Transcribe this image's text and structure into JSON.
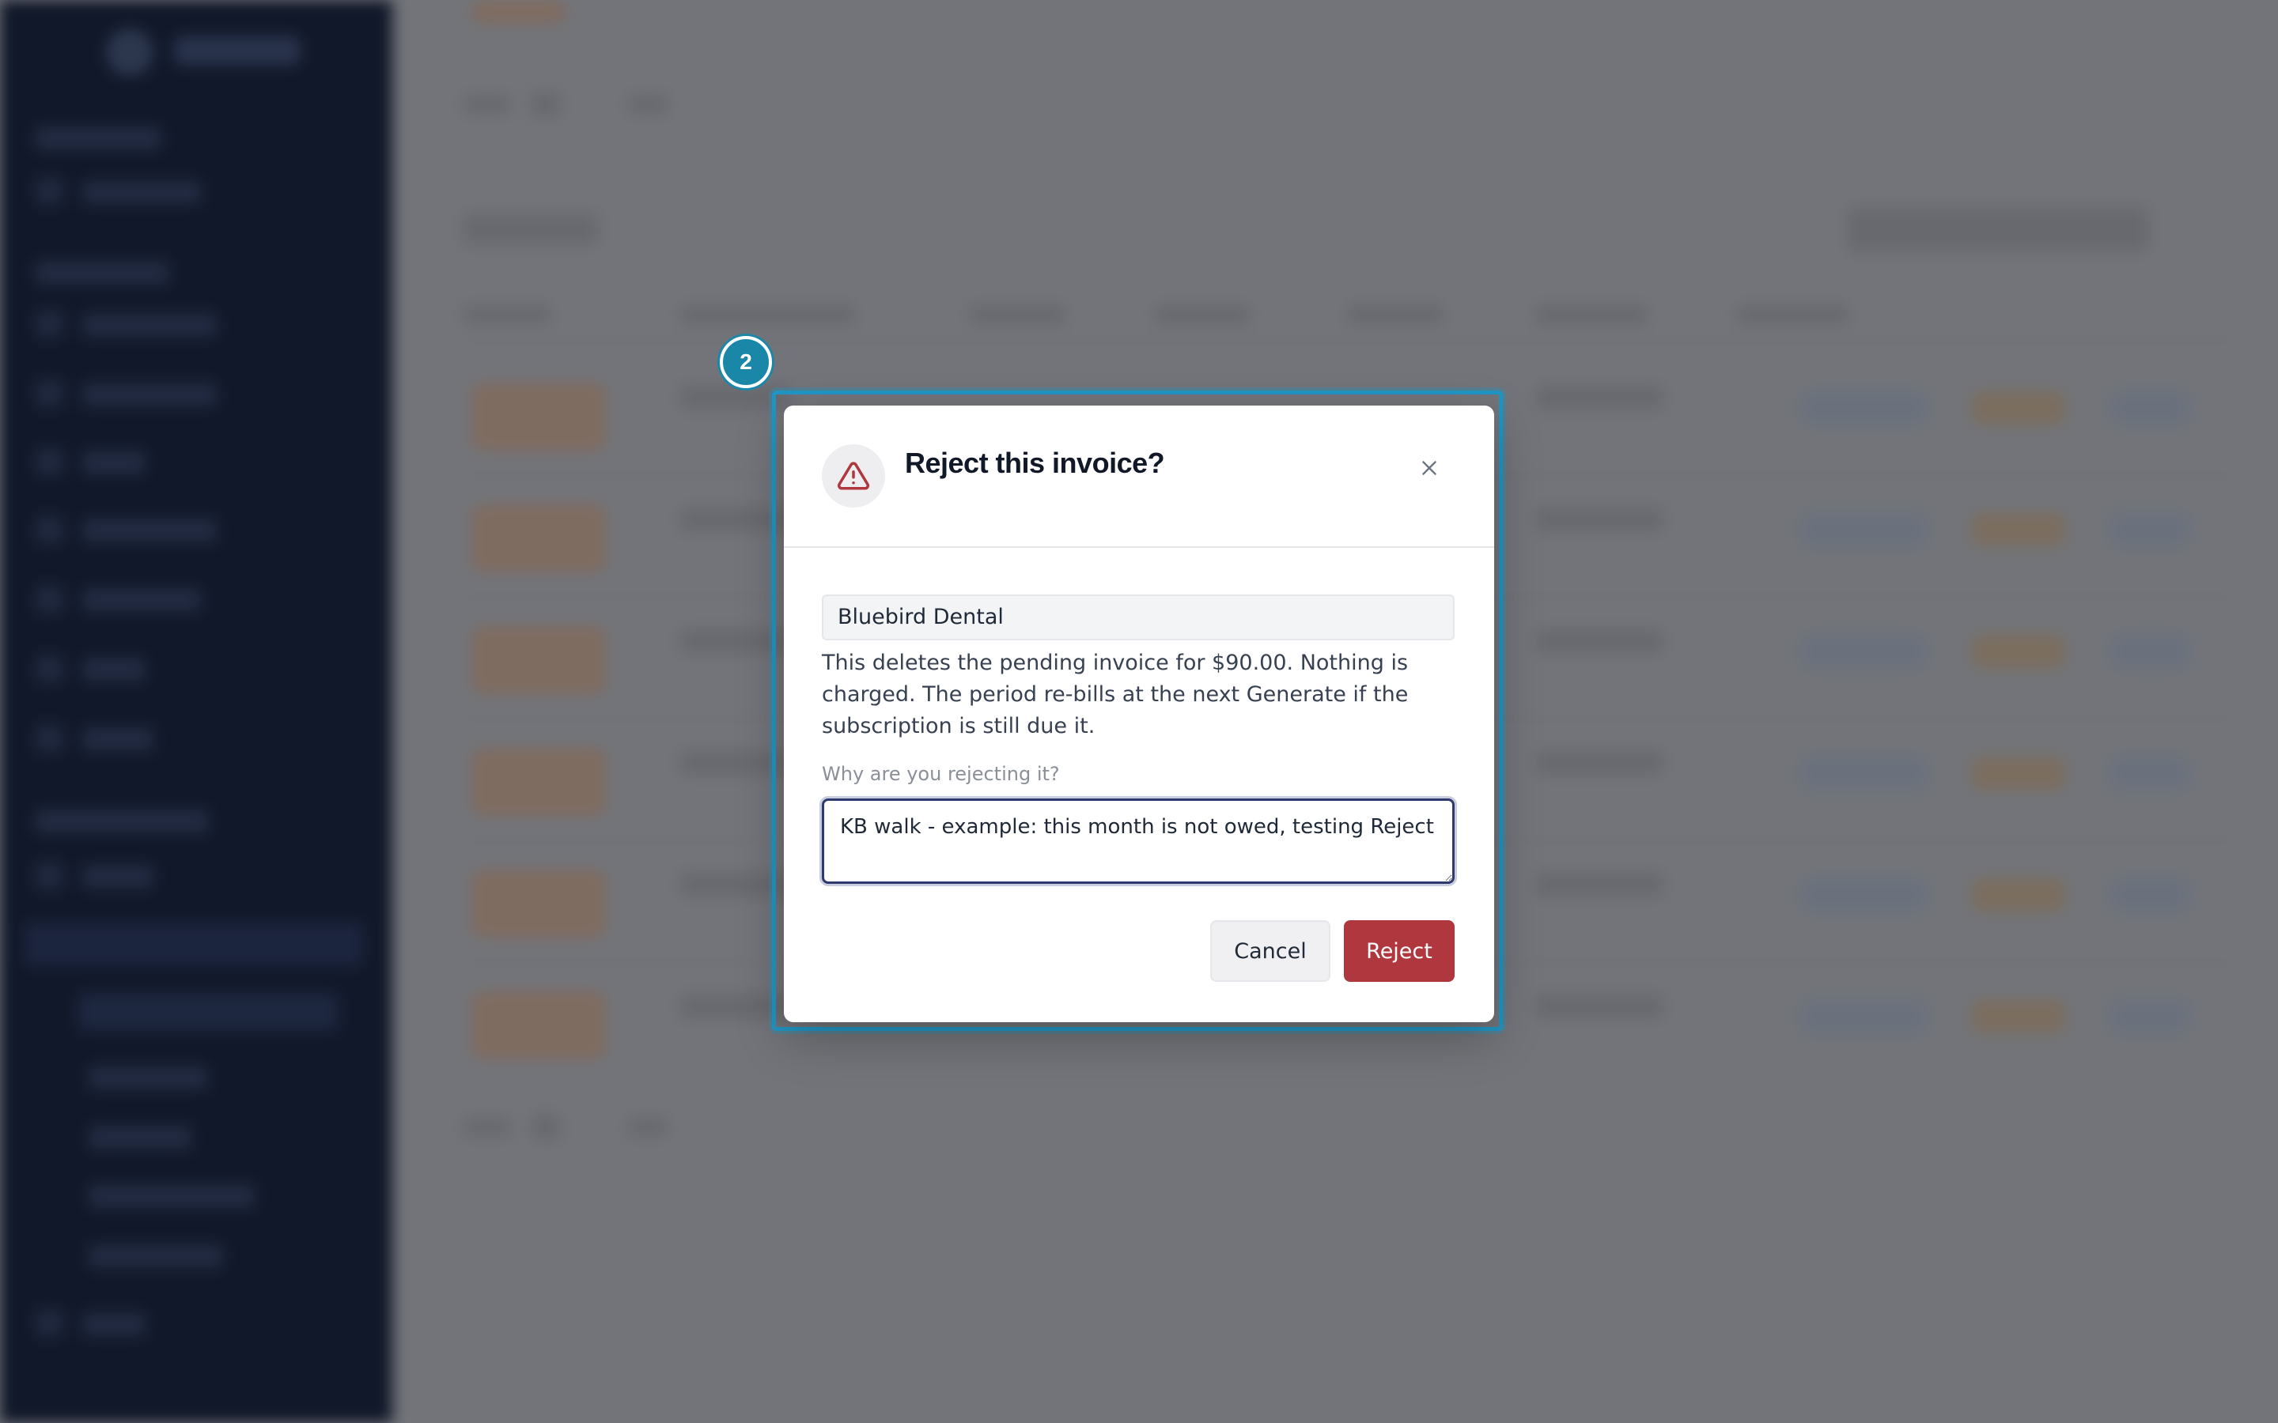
{
  "annotation": {
    "step_number": "2"
  },
  "dialog": {
    "title": "Reject this invoice?",
    "customer_name": "Bluebird Dental",
    "description": "This deletes the pending invoice for $90.00. Nothing is charged. The period re-bills at the next Generate if the subscription is still due it.",
    "reason_label": "Why are you rejecting it?",
    "reason_value": "KB walk - example: this month is not owed, testing Reject",
    "cancel_label": "Cancel",
    "reject_label": "Reject"
  },
  "icons": {
    "warning": "warning-triangle-icon",
    "close": "close-icon"
  },
  "colors": {
    "danger": "#b0373d",
    "highlight": "#2196c4",
    "step_badge": "#1b87a8",
    "sidebar": "#0f1729"
  }
}
